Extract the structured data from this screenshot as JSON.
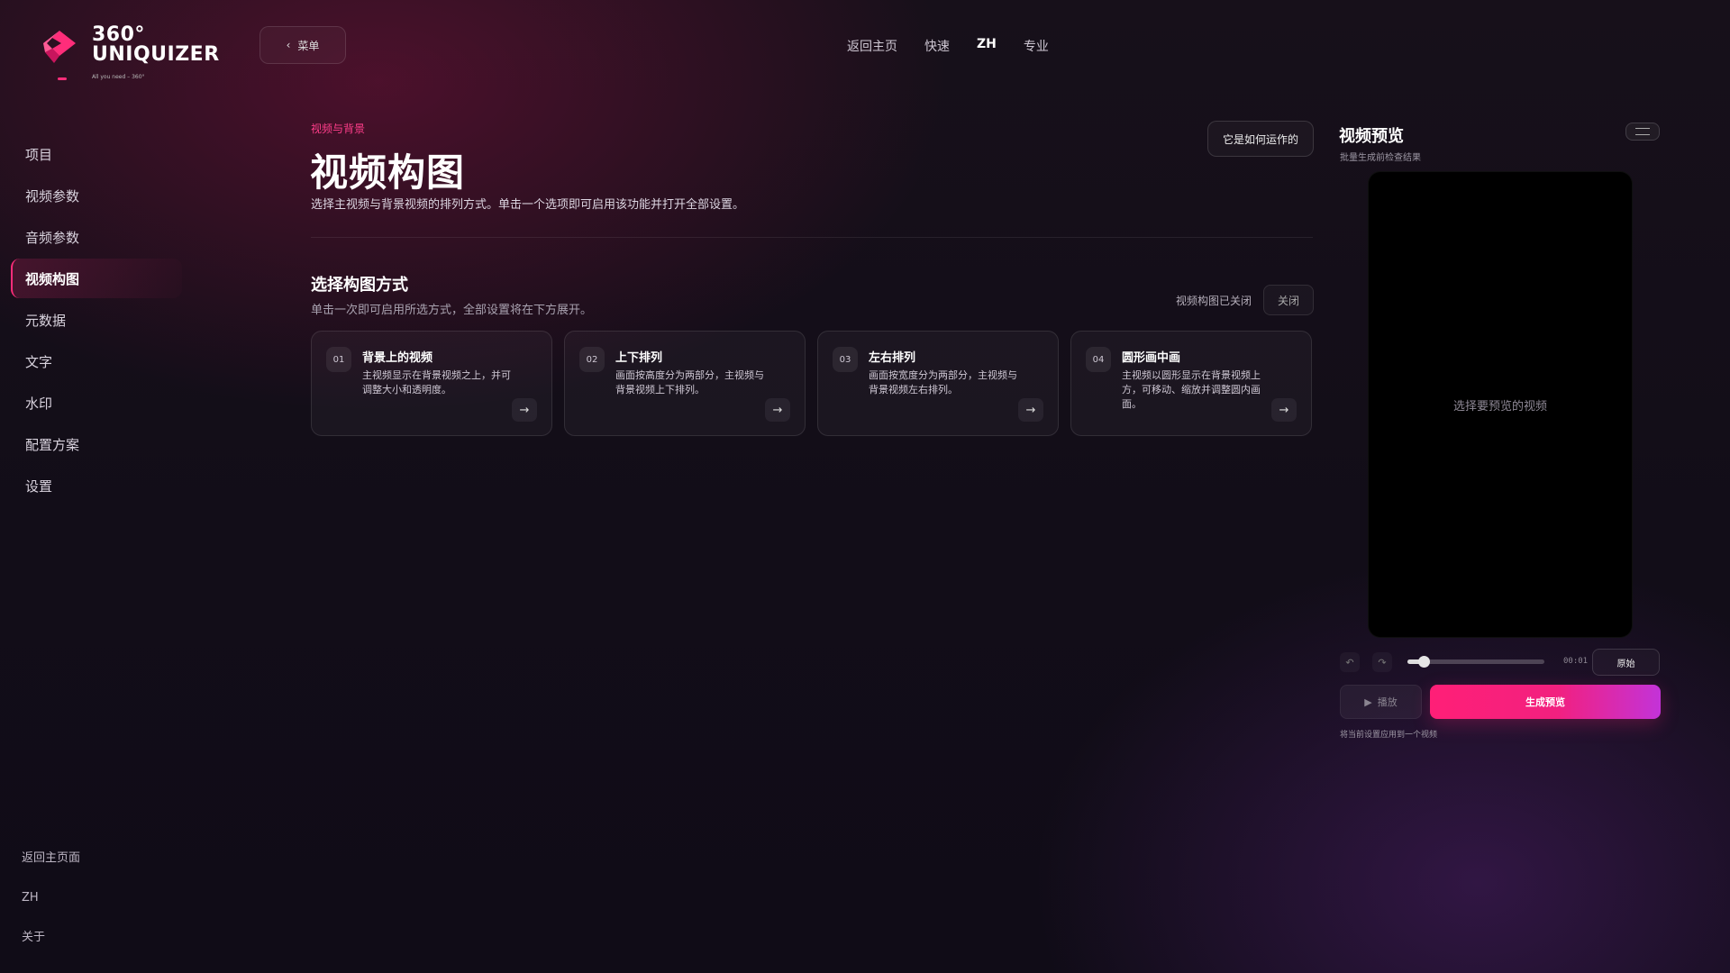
{
  "brand": {
    "name_top": "360°",
    "name_bottom": "UNIQUIZER",
    "tagline": "All you need – 360°",
    "accent_color": "#ff2d7a"
  },
  "menu_button": {
    "icon": "chevron-left-icon",
    "label": "菜单"
  },
  "top_nav": [
    {
      "label": "返回主页"
    },
    {
      "label": "快速"
    },
    {
      "label": "ZH",
      "active": true
    },
    {
      "label": "专业"
    }
  ],
  "sidebar": {
    "items": [
      {
        "label": "项目"
      },
      {
        "label": "视频参数"
      },
      {
        "label": "音频参数"
      },
      {
        "label": "视频构图",
        "active": true
      },
      {
        "label": "元数据"
      },
      {
        "label": "文字"
      },
      {
        "label": "水印"
      },
      {
        "label": "配置方案"
      },
      {
        "label": "设置"
      }
    ],
    "bottom": [
      {
        "label": "返回主页面"
      },
      {
        "label": "ZH"
      },
      {
        "label": "关于"
      }
    ]
  },
  "main": {
    "kicker": "视频与背景",
    "title": "视频构图",
    "description": "选择主视频与背景视频的排列方式。单击一个选项即可启用该功能并打开全部设置。",
    "how_button": "它是如何运作的",
    "section_title": "选择构图方式",
    "section_subtitle": "单击一次即可启用所选方式，全部设置将在下方展开。",
    "status_text": "视频构图已关闭",
    "close_button": "关闭",
    "cards": [
      {
        "num": "01",
        "title": "背景上的视频",
        "desc": "主视频显示在背景视频之上，并可调整大小和透明度。",
        "arrow": "→"
      },
      {
        "num": "02",
        "title": "上下排列",
        "desc": "画面按高度分为两部分，主视频与背景视频上下排列。",
        "arrow": "→"
      },
      {
        "num": "03",
        "title": "左右排列",
        "desc": "画面按宽度分为两部分，主视频与背景视频左右排列。",
        "arrow": "→"
      },
      {
        "num": "04",
        "title": "圆形画中画",
        "desc": "主视频以圆形显示在背景视频上方，可移动、缩放并调整圆内画面。",
        "arrow": "→"
      }
    ]
  },
  "preview_panel": {
    "title": "视频预览",
    "subtitle": "批量生成前检查结果",
    "placeholder": "选择要预览的视频",
    "undo_icon": "undo-icon",
    "redo_icon": "redo-icon",
    "seek_progress": 0.12,
    "time": "00:01",
    "original_button": "原始",
    "play_button": "播放",
    "play_icon": "play-icon",
    "generate_button": "生成预览",
    "apply_note": "将当前设置应用到一个视频",
    "generate_gradient": [
      "#ff1f77",
      "#c333d8"
    ]
  }
}
